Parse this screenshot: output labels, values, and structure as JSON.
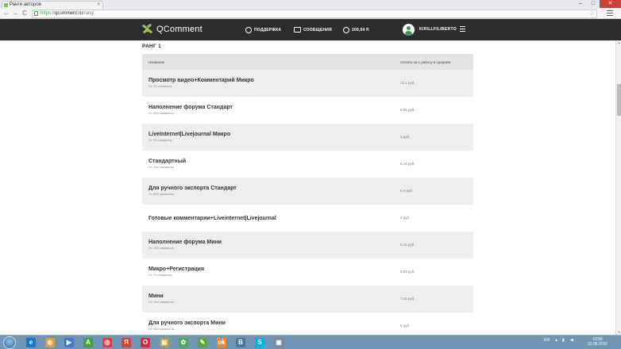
{
  "browser": {
    "tab_title": "Ранги авторов",
    "tab_close": "×",
    "url_protocol": "https://",
    "url_host": "qcomment.ru",
    "url_path": "/rang",
    "back": "←",
    "forward": "→",
    "reload": "C",
    "star": "☆",
    "win_min": "–",
    "win_max": "□",
    "win_close": "✕"
  },
  "header": {
    "logo_text": "QComment",
    "nav_support": "ПОДДЕРЖКА",
    "nav_messages": "СООБЩЕНИЯ",
    "nav_balance": "209,04 Р.",
    "username": "KIRILLFILIBERTO"
  },
  "page": {
    "rank_title": "РАНГ 1",
    "table": {
      "col_name": "Название",
      "col_price": "Оплата за 1 работу в среднем",
      "rows": [
        {
          "name": "Просмотр видео+Комментарий Микро",
          "sub": "От 75 символов",
          "price": "12.1 руб."
        },
        {
          "name": "Наполнение форума Стандарт",
          "sub": "От 300 символов",
          "price": "6.05 руб."
        },
        {
          "name": "LiveInternet|Livejournal Микро",
          "sub": "От 75 символов",
          "price": "3 руб."
        },
        {
          "name": "Стандартный",
          "sub": "От 300 символов",
          "price": "6.15 руб."
        },
        {
          "name": "Для ручного экспорта Стандарт",
          "sub": "От 300 символов",
          "price": "6.4 руб."
        },
        {
          "name": "Готовые комментарии+Liveinternet|Livejournal",
          "sub": "",
          "price": "4 руб."
        },
        {
          "name": "Наполнение форума Мини",
          "sub": "От 150 символов",
          "price": "6.15 руб."
        },
        {
          "name": "Микро+Регистрация",
          "sub": "От 75 символов",
          "price": "6.03 руб."
        },
        {
          "name": "Мини",
          "sub": "От 150 символов",
          "price": "7.15 руб."
        },
        {
          "name": "Для ручного экспорта Мини",
          "sub": "От 150 символов",
          "price": "6 руб."
        }
      ]
    }
  },
  "taskbar": {
    "items": [
      {
        "label": "e",
        "color": "#1e73c8"
      },
      {
        "label": "◉",
        "color": "#e89b2a"
      },
      {
        "label": "▶",
        "color": "#3a7ad0"
      },
      {
        "label": "A",
        "color": "#43a047"
      },
      {
        "label": "◎",
        "color": "#db4437"
      },
      {
        "label": "Я",
        "color": "#e53935"
      },
      {
        "label": "O",
        "color": "#d32f2f"
      },
      {
        "label": "▤",
        "color": "#c59b3a"
      },
      {
        "label": "✿",
        "color": "#4caf50"
      },
      {
        "label": "✎",
        "color": "#5aa83a"
      },
      {
        "label": "ok",
        "color": "#f08a24"
      },
      {
        "label": "В",
        "color": "#4a76a8"
      },
      {
        "label": "S",
        "color": "#00aff0"
      },
      {
        "label": "▣",
        "color": "#7c8aa0"
      }
    ],
    "lang": "EN",
    "time": "23:56",
    "date": "22.05.2016"
  }
}
